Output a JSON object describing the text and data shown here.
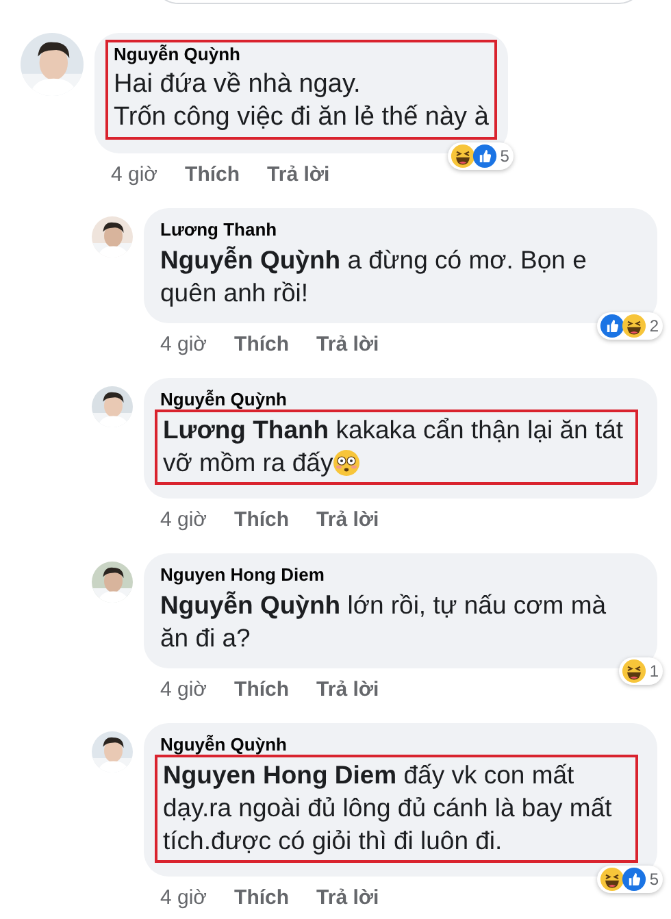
{
  "comments": [
    {
      "kind": "top",
      "author": "Nguyễn Quỳnh",
      "body": "Hai đứa về nhà ngay.\nTrốn công việc đi ăn lẻ thế này à",
      "highlighted": true,
      "time": "4 giờ",
      "like": "Thích",
      "reply": "Trả lời",
      "reactions": [
        {
          "kind": "haha"
        },
        {
          "kind": "like"
        }
      ],
      "reaction_count": "5"
    },
    {
      "kind": "reply",
      "author": "Lương Thanh",
      "body": "**Nguyễn Quỳnh** a đừng có mơ. Bọn e quên anh rồi!",
      "highlighted": false,
      "time": "4 giờ",
      "like": "Thích",
      "reply": "Trả lời",
      "reactions": [
        {
          "kind": "like"
        },
        {
          "kind": "haha"
        }
      ],
      "reaction_count": "2"
    },
    {
      "kind": "reply",
      "author": "Nguyễn Quỳnh",
      "body": "**Lương Thanh** kakaka cẩn thận lại ăn tát vỡ mồm ra đấy",
      "emojis": [
        {
          "kind": "flushed"
        }
      ],
      "highlighted": true,
      "time": "4 giờ",
      "like": "Thích",
      "reply": "Trả lời"
    },
    {
      "kind": "reply",
      "author": "Nguyen Hong Diem",
      "body": "**Nguyễn Quỳnh** lớn rồi, tự nấu cơm mà ăn đi a?",
      "highlighted": false,
      "time": "4 giờ",
      "like": "Thích",
      "reply": "Trả lời",
      "reactions": [
        {
          "kind": "haha"
        }
      ],
      "reaction_count": "1"
    },
    {
      "kind": "reply",
      "author": "Nguyễn Quỳnh",
      "body": "**Nguyen Hong Diem** đấy vk con mất dạy.ra ngoài đủ lông đủ cánh là bay mất tích.được có giỏi thì đi luôn đi.",
      "highlighted": true,
      "time": "4 giờ",
      "like": "Thích",
      "reply": "Trả lời",
      "reactions": [
        {
          "kind": "haha"
        },
        {
          "kind": "like"
        }
      ],
      "reaction_count": "5"
    }
  ]
}
